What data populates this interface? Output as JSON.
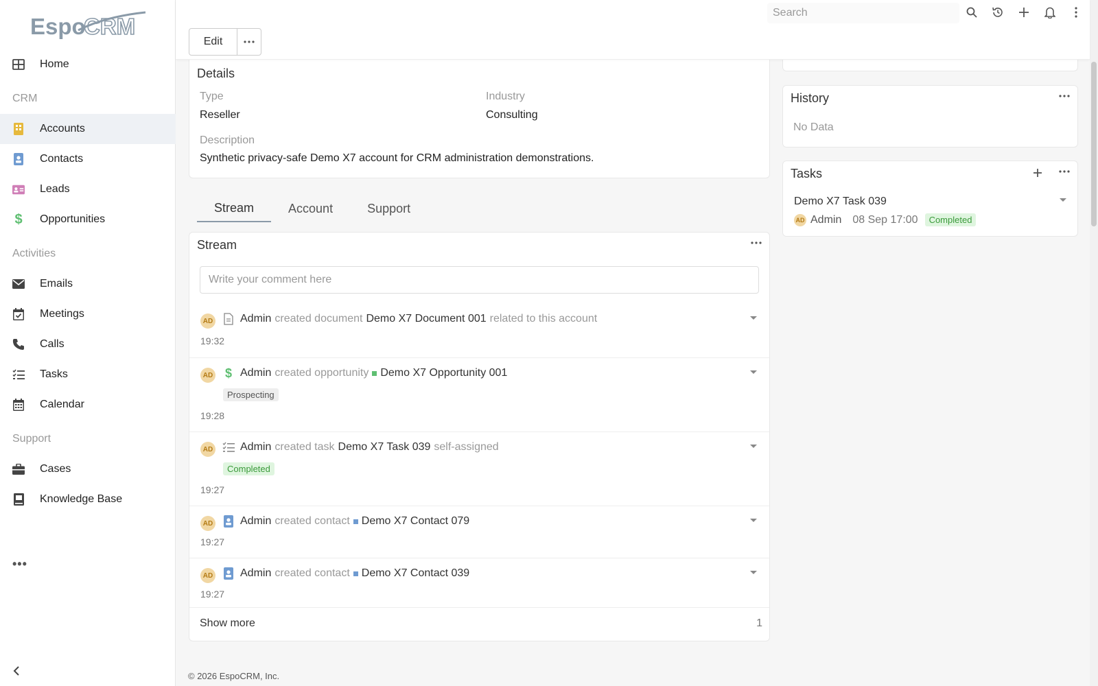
{
  "app": {
    "logo_text": "EspoCRM"
  },
  "sidebar": {
    "items": [
      {
        "label": "Home"
      },
      {
        "group": "CRM"
      },
      {
        "label": "Accounts"
      },
      {
        "label": "Contacts"
      },
      {
        "label": "Leads"
      },
      {
        "label": "Opportunities"
      },
      {
        "group": "Activities"
      },
      {
        "label": "Emails"
      },
      {
        "label": "Meetings"
      },
      {
        "label": "Calls"
      },
      {
        "label": "Tasks"
      },
      {
        "label": "Calendar"
      },
      {
        "group": "Support"
      },
      {
        "label": "Cases"
      },
      {
        "label": "Knowledge Base"
      }
    ],
    "more_label": "•••"
  },
  "header": {
    "search_placeholder": "Search",
    "edit_label": "Edit",
    "more_label": "•••"
  },
  "details": {
    "title": "Details",
    "type_label": "Type",
    "type_value": "Reseller",
    "industry_label": "Industry",
    "industry_value": "Consulting",
    "description_label": "Description",
    "description_value": "Synthetic privacy-safe Demo X7 account for CRM administration demonstrations."
  },
  "tabs": [
    {
      "label": "Stream",
      "active": true
    },
    {
      "label": "Account"
    },
    {
      "label": "Support"
    }
  ],
  "stream": {
    "title": "Stream",
    "comment_placeholder": "Write your comment here",
    "notes": [
      {
        "avatar": "AD",
        "actor": "Admin",
        "verb": "created document",
        "target": "Demo X7 Document 001",
        "suffix": "related to this account",
        "time": "19:32"
      },
      {
        "avatar": "AD",
        "actor": "Admin",
        "verb": "created opportunity",
        "target": "Demo X7 Opportunity 001",
        "badge": "Prospecting",
        "time": "19:28"
      },
      {
        "avatar": "AD",
        "actor": "Admin",
        "verb": "created task",
        "target": "Demo X7 Task 039",
        "suffix": "self-assigned",
        "badge": "Completed",
        "time": "19:27"
      },
      {
        "avatar": "AD",
        "actor": "Admin",
        "verb": "created contact",
        "target": "Demo X7 Contact 079",
        "time": "19:27"
      },
      {
        "avatar": "AD",
        "actor": "Admin",
        "verb": "created contact",
        "target": "Demo X7 Contact 039",
        "time": "19:27"
      }
    ],
    "show_more_label": "Show more",
    "show_more_count": "1"
  },
  "history": {
    "title": "History",
    "empty_text": "No Data"
  },
  "tasks": {
    "title": "Tasks",
    "items": [
      {
        "name": "Demo X7 Task 039",
        "avatar": "AD",
        "assignee": "Admin",
        "date": "08 Sep 17:00",
        "status": "Completed"
      }
    ]
  },
  "footer": {
    "text": "© 2026 EspoCRM, Inc."
  },
  "colors": {
    "accent": "#8a9aa8",
    "accounts_icon": "#e6b93d",
    "contacts_icon": "#6f9bd1",
    "leads_icon": "#d07fb7",
    "opportunity_icon": "#5fbf72",
    "completed_badge": "#3a9a3a",
    "avatar_bg": "#f1d7a3"
  }
}
